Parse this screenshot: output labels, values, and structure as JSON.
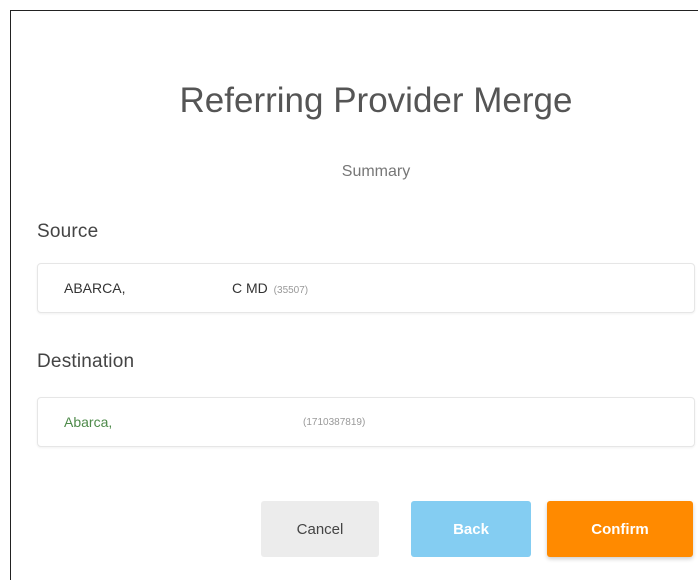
{
  "dialog": {
    "title": "Referring Provider Merge",
    "subtitle": "Summary"
  },
  "source": {
    "label": "Source",
    "name": "ABARCA,",
    "suffix": "C MD",
    "id": "(35507)"
  },
  "destination": {
    "label": "Destination",
    "name": "Abarca,",
    "id": "(1710387819)"
  },
  "buttons": {
    "cancel": "Cancel",
    "back": "Back",
    "confirm": "Confirm"
  },
  "colors": {
    "confirm": "#ff8a00",
    "back": "#84cdf2",
    "cancel": "#ececec",
    "destination_name": "#4e8a4a"
  }
}
